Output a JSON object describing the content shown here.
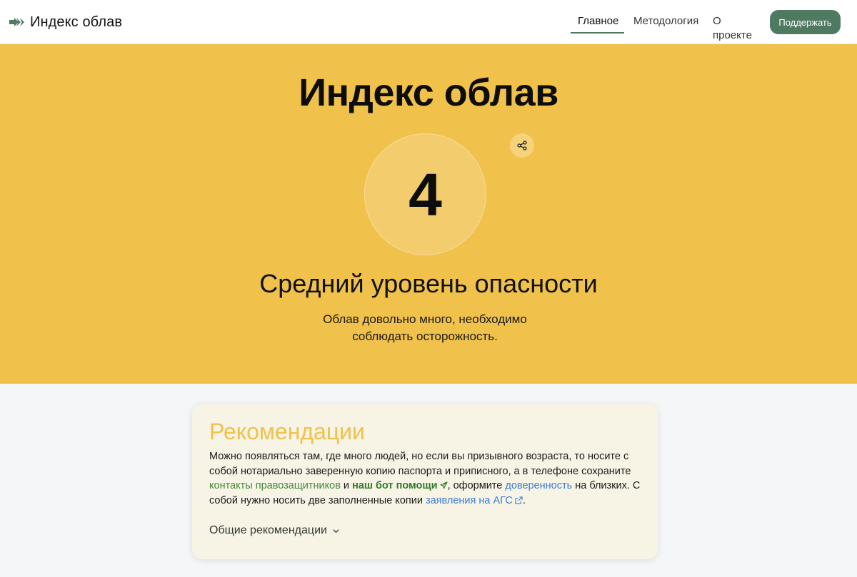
{
  "header": {
    "brand_icon": "double-arrow-icon",
    "brand_name": "Индекс облав",
    "nav": [
      {
        "label": "Главное",
        "active": true
      },
      {
        "label": "Методология",
        "active": false
      },
      {
        "label": "О проекте",
        "active": false
      }
    ],
    "support_label": "Поддержать"
  },
  "hero": {
    "title": "Индекс облав",
    "index_value": "4",
    "share_icon": "share-icon",
    "level_title": "Средний уровень опасности",
    "description": "Облав довольно много, необходимо соблюдать осторожность."
  },
  "recommendations": {
    "title": "Рекомендации",
    "text_1": "Можно появляться там, где много людей, но если вы призывного возраста, то носите с собой нотариально заверенную копию паспорта и приписного, а в телефоне сохраните ",
    "link_contacts": "контакты правозащитников",
    "text_2": " и ",
    "link_bot": "наш бот помощи",
    "text_3": ", оформите ",
    "link_power_of_attorney": "доверенность",
    "text_4": " на близких. С собой нужно носить две заполненные копии ",
    "link_ags": "заявления на АГС",
    "text_5": ".",
    "general_label": "Общие рекомендации"
  },
  "colors": {
    "hero_bg": "#f0c14b",
    "accent_green": "#4e7a62",
    "link_blue": "#3a7bd5",
    "link_green": "#3f8a3a"
  }
}
